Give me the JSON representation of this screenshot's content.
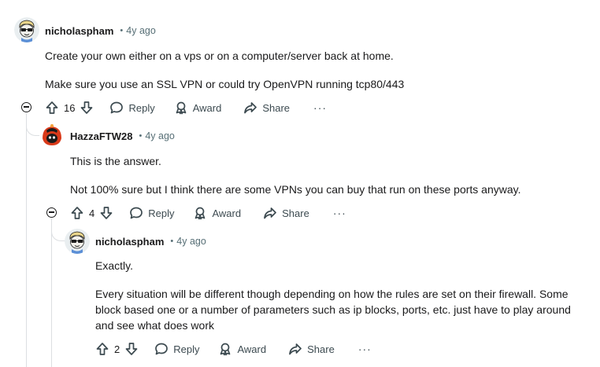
{
  "comments": [
    {
      "author": "nicholaspham",
      "time": "4y ago",
      "paragraphs": [
        "Create your own either on a vps or on a computer/server back at home.",
        "Make sure you use an SSL VPN or could try OpenVPN running tcp80/443"
      ],
      "score": "16",
      "reply_label": "Reply",
      "award_label": "Award",
      "share_label": "Share",
      "more_label": "···"
    },
    {
      "author": "HazzaFTW28",
      "time": "4y ago",
      "paragraphs": [
        "This is the answer.",
        "Not 100% sure but I think there are some VPNs you can buy that run on these ports anyway."
      ],
      "score": "4",
      "reply_label": "Reply",
      "award_label": "Award",
      "share_label": "Share",
      "more_label": "···"
    },
    {
      "author": "nicholaspham",
      "time": "4y ago",
      "paragraphs": [
        "Exactly.",
        "Every situation will be different though depending on how the rules are set on their firewall. Some block based one or a number of parameters such as ip blocks, ports, etc. just have to play around and see what does work"
      ],
      "score": "2",
      "reply_label": "Reply",
      "award_label": "Award",
      "share_label": "Share",
      "more_label": "···"
    }
  ],
  "separator": "•",
  "icons": {
    "upvote": "upvote-arrow-icon",
    "downvote": "downvote-arrow-icon",
    "reply": "speech-bubble-icon",
    "award": "award-ribbon-icon",
    "share": "share-arrow-icon",
    "collapse": "collapse-minus-icon"
  }
}
